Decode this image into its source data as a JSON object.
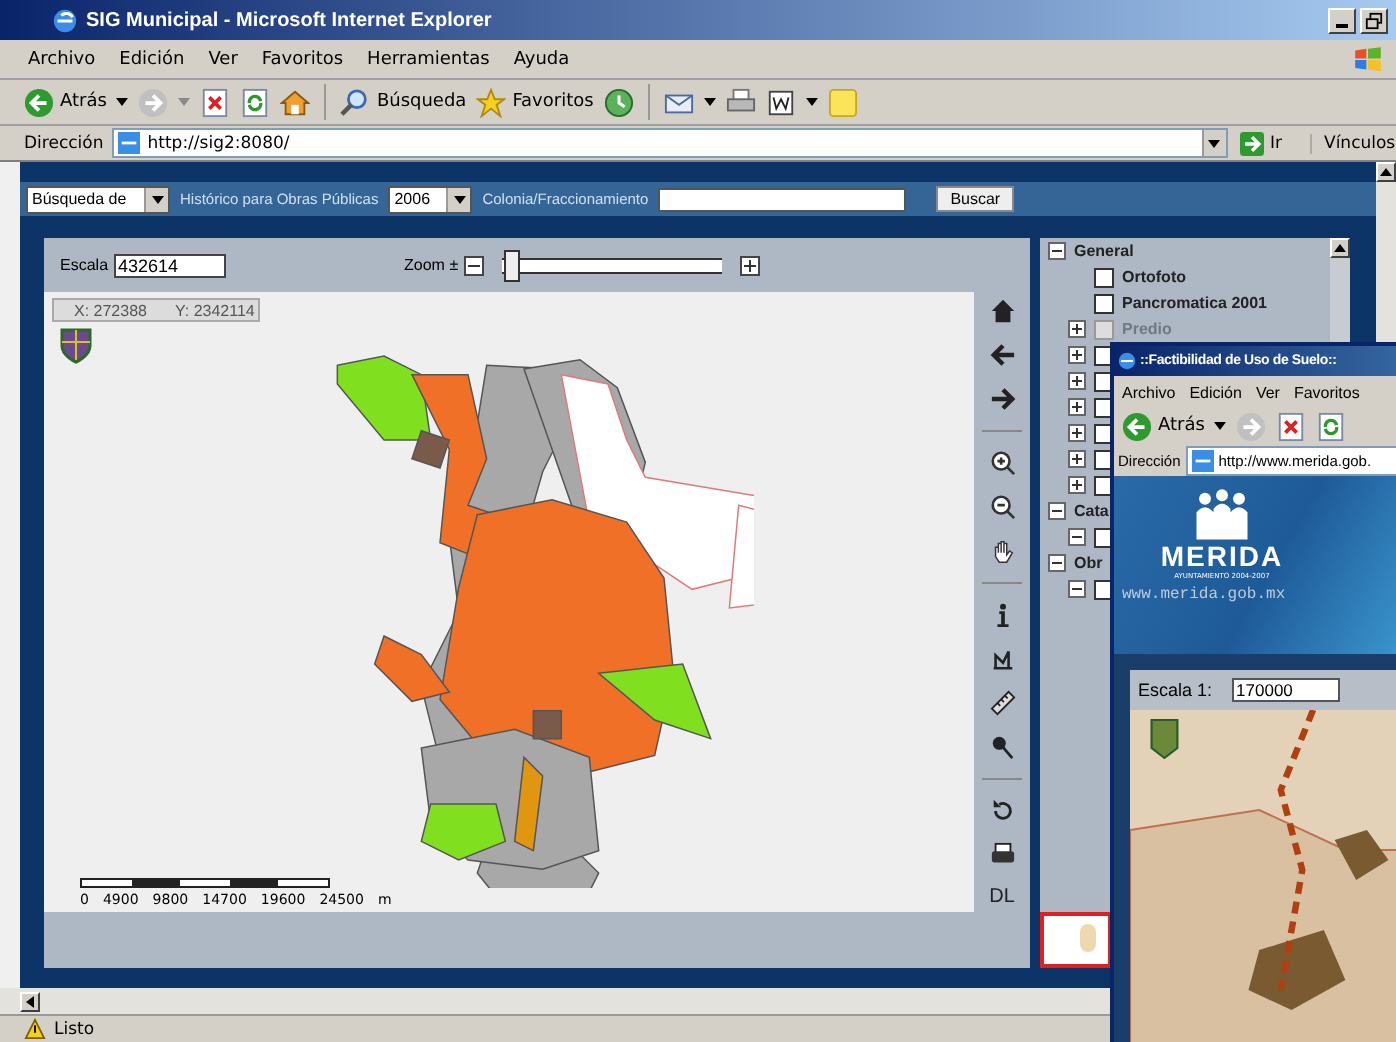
{
  "window": {
    "title": "SIG Municipal - Microsoft Internet Explorer"
  },
  "menu": [
    "Archivo",
    "Edición",
    "Ver",
    "Favoritos",
    "Herramientas",
    "Ayuda"
  ],
  "toolbar": {
    "back": "Atrás",
    "search": "Búsqueda",
    "favorites": "Favoritos"
  },
  "address_bar": {
    "label": "Dirección",
    "value": "http://sig2:8080/",
    "go": "Ir",
    "links": "Vínculos"
  },
  "search_bar": {
    "mode": "Búsqueda de",
    "history_label": "Histórico para Obras Públicas",
    "year": "2006",
    "colonia_label": "Colonia/Fraccionamiento",
    "button": "Buscar"
  },
  "map": {
    "scale_label": "Escala",
    "scale": "432614",
    "zoom_label": "Zoom ±",
    "zoom": {
      "level": 0.04
    },
    "coord_x": "X: 272388",
    "coord_y": "Y: 2342114",
    "scale_bar": [
      "0",
      "4900",
      "9800",
      "14700",
      "19600",
      "24500",
      "m"
    ]
  },
  "tools": [
    {
      "kind": "home"
    },
    {
      "kind": "back"
    },
    {
      "kind": "forward"
    },
    {
      "kind": "separator"
    },
    {
      "kind": "zoom-in"
    },
    {
      "kind": "zoom-out"
    },
    {
      "kind": "pan"
    },
    {
      "kind": "separator"
    },
    {
      "kind": "info"
    },
    {
      "kind": "area"
    },
    {
      "kind": "ruler"
    },
    {
      "kind": "pin"
    },
    {
      "kind": "separator"
    },
    {
      "kind": "refresh"
    },
    {
      "kind": "print"
    },
    {
      "kind": "text",
      "label": "DL"
    }
  ],
  "layers": [
    {
      "label": "General",
      "expanded": true,
      "children": [
        {
          "label": "Ortofoto",
          "checked": false,
          "disabled": false
        },
        {
          "label": "Pancromatica 2001",
          "checked": false,
          "disabled": false
        },
        {
          "label": "Predio",
          "checked": false,
          "disabled": true,
          "expanded": false
        },
        {
          "checked": false,
          "disabled": false,
          "expanded": false
        },
        {
          "checked": false,
          "disabled": false,
          "expanded": false
        },
        {
          "checked": false,
          "disabled": false,
          "expanded": false
        },
        {
          "checked": false,
          "disabled": false,
          "expanded": false
        },
        {
          "checked": false,
          "disabled": false,
          "expanded": false
        },
        {
          "checked": false,
          "disabled": false,
          "expanded": false
        }
      ]
    },
    {
      "label": "Cata",
      "expanded": true,
      "children": [
        {
          "checked": false,
          "disabled": false,
          "expanded": true
        }
      ]
    },
    {
      "label": "Obr",
      "expanded": true,
      "children": [
        {
          "checked": false,
          "disabled": false,
          "expanded": true
        }
      ]
    }
  ],
  "popup_window": {
    "title": "::Factibilidad de Uso de Suelo::",
    "menu": [
      "Archivo",
      "Edición",
      "Ver",
      "Favoritos"
    ],
    "back": "Atrás",
    "address_label": "Dirección",
    "address": "http://www.merida.gob.",
    "logo": "MERIDA",
    "logo_subtitle": "AYUNTAMIENTO 2004-2007",
    "website": "www.merida.gob.mx",
    "scale_label": "Escala 1:",
    "scale": "170000"
  },
  "status_bar": {
    "text": "Listo"
  }
}
